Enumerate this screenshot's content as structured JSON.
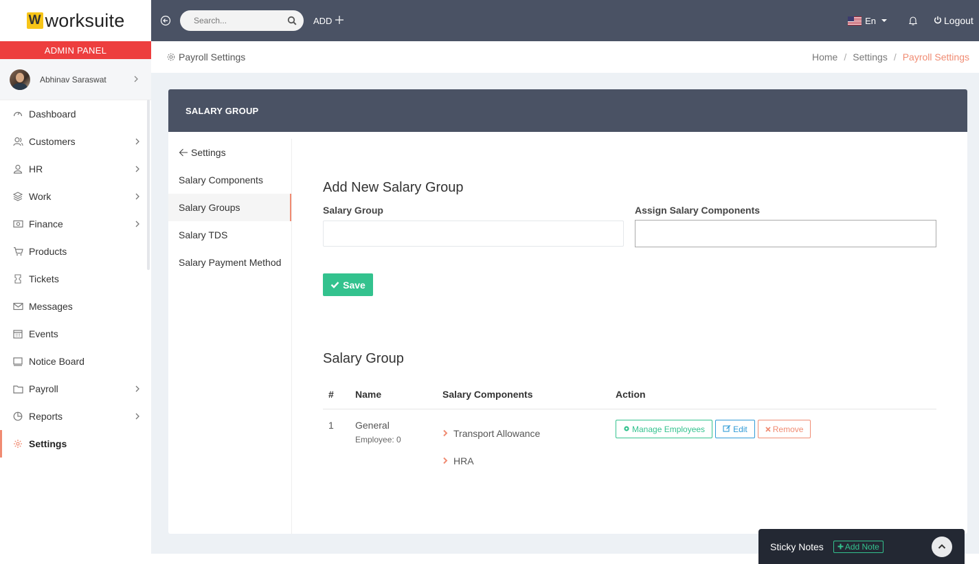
{
  "brand": {
    "logo_letter": "W",
    "name": "worksuite",
    "panel_label": "ADMIN PANEL"
  },
  "user": {
    "name": "Abhinav Saraswat"
  },
  "sidebar": {
    "items": [
      {
        "label": "Dashboard",
        "icon": "dashboard-icon",
        "has_children": false
      },
      {
        "label": "Customers",
        "icon": "users-icon",
        "has_children": true
      },
      {
        "label": "HR",
        "icon": "user-icon",
        "has_children": true
      },
      {
        "label": "Work",
        "icon": "layers-icon",
        "has_children": true
      },
      {
        "label": "Finance",
        "icon": "money-icon",
        "has_children": true
      },
      {
        "label": "Products",
        "icon": "cart-icon",
        "has_children": false
      },
      {
        "label": "Tickets",
        "icon": "ticket-icon",
        "has_children": false
      },
      {
        "label": "Messages",
        "icon": "envelope-icon",
        "has_children": false
      },
      {
        "label": "Events",
        "icon": "calendar-icon",
        "has_children": false
      },
      {
        "label": "Notice Board",
        "icon": "monitor-icon",
        "has_children": false
      },
      {
        "label": "Payroll",
        "icon": "folder-icon",
        "has_children": true
      },
      {
        "label": "Reports",
        "icon": "pie-chart-icon",
        "has_children": true
      },
      {
        "label": "Settings",
        "icon": "gear-icon",
        "has_children": false,
        "active": true
      }
    ]
  },
  "topbar": {
    "search_placeholder": "Search...",
    "add_label": "ADD",
    "language": "En",
    "logout_label": "Logout"
  },
  "breadcrumb": {
    "page_title": "Payroll Settings",
    "items": [
      "Home",
      "Settings",
      "Payroll Settings"
    ]
  },
  "card": {
    "header": "SALARY GROUP",
    "settings_nav": {
      "back_label": "Settings",
      "items": [
        "Salary Components",
        "Salary Groups",
        "Salary TDS",
        "Salary Payment Method"
      ],
      "active_index": 1
    },
    "form": {
      "title": "Add New Salary Group",
      "salary_group_label": "Salary Group",
      "salary_group_value": "",
      "assign_label": "Assign Salary Components",
      "save_label": "Save"
    },
    "list": {
      "title": "Salary Group",
      "columns": [
        "#",
        "Name",
        "Salary Components",
        "Action"
      ],
      "rows": [
        {
          "index": "1",
          "name": "General",
          "employees": "Employee: 0",
          "components": [
            "Transport Allowance",
            "HRA"
          ],
          "actions": {
            "manage": "Manage Employees",
            "edit": "Edit",
            "remove": "Remove"
          }
        }
      ]
    }
  },
  "sticky": {
    "label": "Sticky Notes",
    "add_note": "Add Note"
  },
  "colors": {
    "accent": "#f08b72",
    "success": "#33c28e",
    "info": "#2f9ad6",
    "dark": "#4a5264",
    "danger_bar": "#ed3e3e"
  }
}
